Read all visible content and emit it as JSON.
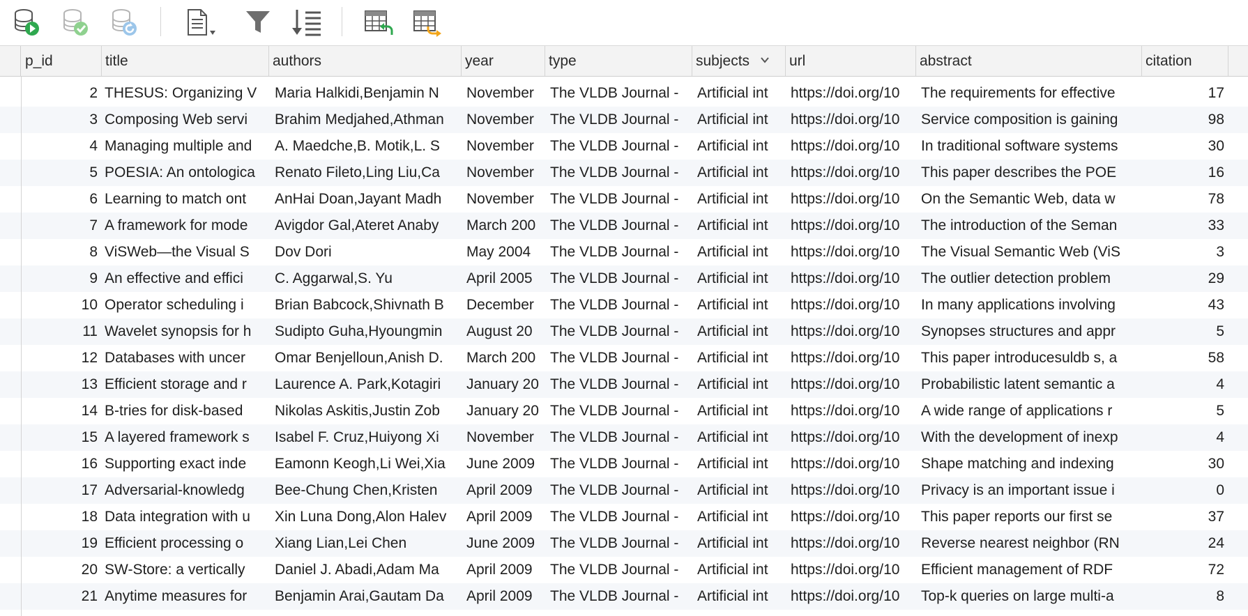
{
  "toolbar": {
    "buttons": [
      {
        "name": "run-query-icon"
      },
      {
        "name": "commit-icon"
      },
      {
        "name": "rollback-icon"
      },
      {
        "name": "export-document-icon"
      },
      {
        "name": "filter-icon"
      },
      {
        "name": "sort-icon"
      },
      {
        "name": "import-table-icon"
      },
      {
        "name": "export-table-icon"
      }
    ],
    "colors": {
      "green": "#2fa84f",
      "green_light": "#8fd18f",
      "blue_light": "#9cc6ea",
      "orange": "#f2a51a",
      "gray": "#6e6e6e"
    }
  },
  "columns": [
    "p_id",
    "title",
    "authors",
    "year",
    "type",
    "subjects",
    "url",
    "abstract",
    "citation"
  ],
  "rows": [
    {
      "p_id": "2",
      "title": "THESUS: Organizing V",
      "authors": "Maria Halkidi,Benjamin N",
      "year": "November",
      "type": "The VLDB Journal -",
      "subjects": "Artificial int",
      "url": "https://doi.org/10",
      "abstract": "The requirements for effective",
      "citation": "17"
    },
    {
      "p_id": "3",
      "title": "Composing Web servi",
      "authors": "Brahim Medjahed,Athman",
      "year": "November",
      "type": "The VLDB Journal -",
      "subjects": "Artificial int",
      "url": "https://doi.org/10",
      "abstract": "Service composition is gaining",
      "citation": "98"
    },
    {
      "p_id": "4",
      "title": "Managing multiple and",
      "authors": "A. Maedche,B. Motik,L. S",
      "year": "November",
      "type": "The VLDB Journal -",
      "subjects": "Artificial int",
      "url": "https://doi.org/10",
      "abstract": "In traditional software systems",
      "citation": "30"
    },
    {
      "p_id": "5",
      "title": "POESIA: An ontologica",
      "authors": "Renato Fileto,Ling Liu,Ca",
      "year": "November",
      "type": "The VLDB Journal -",
      "subjects": "Artificial int",
      "url": "https://doi.org/10",
      "abstract": "This paper describes the POE",
      "citation": "16"
    },
    {
      "p_id": "6",
      "title": "Learning to match ont",
      "authors": "AnHai Doan,Jayant Madh",
      "year": "November",
      "type": "The VLDB Journal -",
      "subjects": "Artificial int",
      "url": "https://doi.org/10",
      "abstract": "On the Semantic Web, data w",
      "citation": "78"
    },
    {
      "p_id": "7",
      "title": "A framework for mode",
      "authors": "Avigdor Gal,Ateret Anaby",
      "year": "March 200",
      "type": "The VLDB Journal -",
      "subjects": "Artificial int",
      "url": "https://doi.org/10",
      "abstract": "The introduction of the Seman",
      "citation": "33"
    },
    {
      "p_id": "8",
      "title": "ViSWeb—the Visual S",
      "authors": "Dov Dori",
      "year": "May 2004",
      "type": "The VLDB Journal -",
      "subjects": "Artificial int",
      "url": "https://doi.org/10",
      "abstract": "The Visual Semantic Web (ViS",
      "citation": "3"
    },
    {
      "p_id": "9",
      "title": "An effective and effici",
      "authors": "C. Aggarwal,S. Yu",
      "year": "April 2005",
      "type": "The VLDB Journal -",
      "subjects": "Artificial int",
      "url": "https://doi.org/10",
      "abstract": "The outlier detection problem",
      "citation": "29"
    },
    {
      "p_id": "10",
      "title": "Operator scheduling i",
      "authors": "Brian Babcock,Shivnath B",
      "year": "December",
      "type": "The VLDB Journal -",
      "subjects": "Artificial int",
      "url": "https://doi.org/10",
      "abstract": "In many applications involving",
      "citation": "43"
    },
    {
      "p_id": "11",
      "title": "Wavelet synopsis for h",
      "authors": "Sudipto Guha,Hyoungmin",
      "year": "August 20",
      "type": "The VLDB Journal -",
      "subjects": "Artificial int",
      "url": "https://doi.org/10",
      "abstract": "Synopses structures and appr",
      "citation": "5"
    },
    {
      "p_id": "12",
      "title": "Databases with uncer",
      "authors": "Omar Benjelloun,Anish D.",
      "year": "March 200",
      "type": "The VLDB Journal -",
      "subjects": "Artificial int",
      "url": "https://doi.org/10",
      "abstract": "This paper introducesuldb s, a",
      "citation": "58"
    },
    {
      "p_id": "13",
      "title": "Efficient storage and r",
      "authors": "Laurence A. Park,Kotagiri",
      "year": "January 20",
      "type": "The VLDB Journal -",
      "subjects": "Artificial int",
      "url": "https://doi.org/10",
      "abstract": "Probabilistic latent semantic a",
      "citation": "4"
    },
    {
      "p_id": "14",
      "title": "B-tries for disk-based",
      "authors": "Nikolas Askitis,Justin Zob",
      "year": "January 20",
      "type": "The VLDB Journal -",
      "subjects": "Artificial int",
      "url": "https://doi.org/10",
      "abstract": "A wide range of applications r",
      "citation": "5"
    },
    {
      "p_id": "15",
      "title": "A layered framework s",
      "authors": "Isabel F. Cruz,Huiyong Xi",
      "year": "November",
      "type": "The VLDB Journal -",
      "subjects": "Artificial int",
      "url": "https://doi.org/10",
      "abstract": "With the development of inexp",
      "citation": "4"
    },
    {
      "p_id": "16",
      "title": "Supporting exact inde",
      "authors": "Eamonn Keogh,Li Wei,Xia",
      "year": "June 2009",
      "type": "The VLDB Journal -",
      "subjects": "Artificial int",
      "url": "https://doi.org/10",
      "abstract": "Shape matching and indexing",
      "citation": "30"
    },
    {
      "p_id": "17",
      "title": "Adversarial-knowledg",
      "authors": "Bee-Chung Chen,Kristen",
      "year": "April 2009",
      "type": "The VLDB Journal -",
      "subjects": "Artificial int",
      "url": "https://doi.org/10",
      "abstract": "Privacy is an important issue i",
      "citation": "0"
    },
    {
      "p_id": "18",
      "title": "Data integration with u",
      "authors": "Xin Luna Dong,Alon Halev",
      "year": "April 2009",
      "type": "The VLDB Journal -",
      "subjects": "Artificial int",
      "url": "https://doi.org/10",
      "abstract": "This paper reports our first se",
      "citation": "37"
    },
    {
      "p_id": "19",
      "title": "Efficient processing o",
      "authors": "Xiang Lian,Lei Chen",
      "year": "June 2009",
      "type": "The VLDB Journal -",
      "subjects": "Artificial int",
      "url": "https://doi.org/10",
      "abstract": "Reverse nearest neighbor (RN",
      "citation": "24"
    },
    {
      "p_id": "20",
      "title": "SW-Store: a vertically",
      "authors": "Daniel J. Abadi,Adam Ma",
      "year": "April 2009",
      "type": "The VLDB Journal -",
      "subjects": "Artificial int",
      "url": "https://doi.org/10",
      "abstract": "Efficient management of RDF",
      "citation": "72"
    },
    {
      "p_id": "21",
      "title": "Anytime measures for",
      "authors": "Benjamin Arai,Gautam Da",
      "year": "April 2009",
      "type": "The VLDB Journal -",
      "subjects": "Artificial int",
      "url": "https://doi.org/10",
      "abstract": "Top-k queries on large multi-a",
      "citation": "8"
    }
  ]
}
